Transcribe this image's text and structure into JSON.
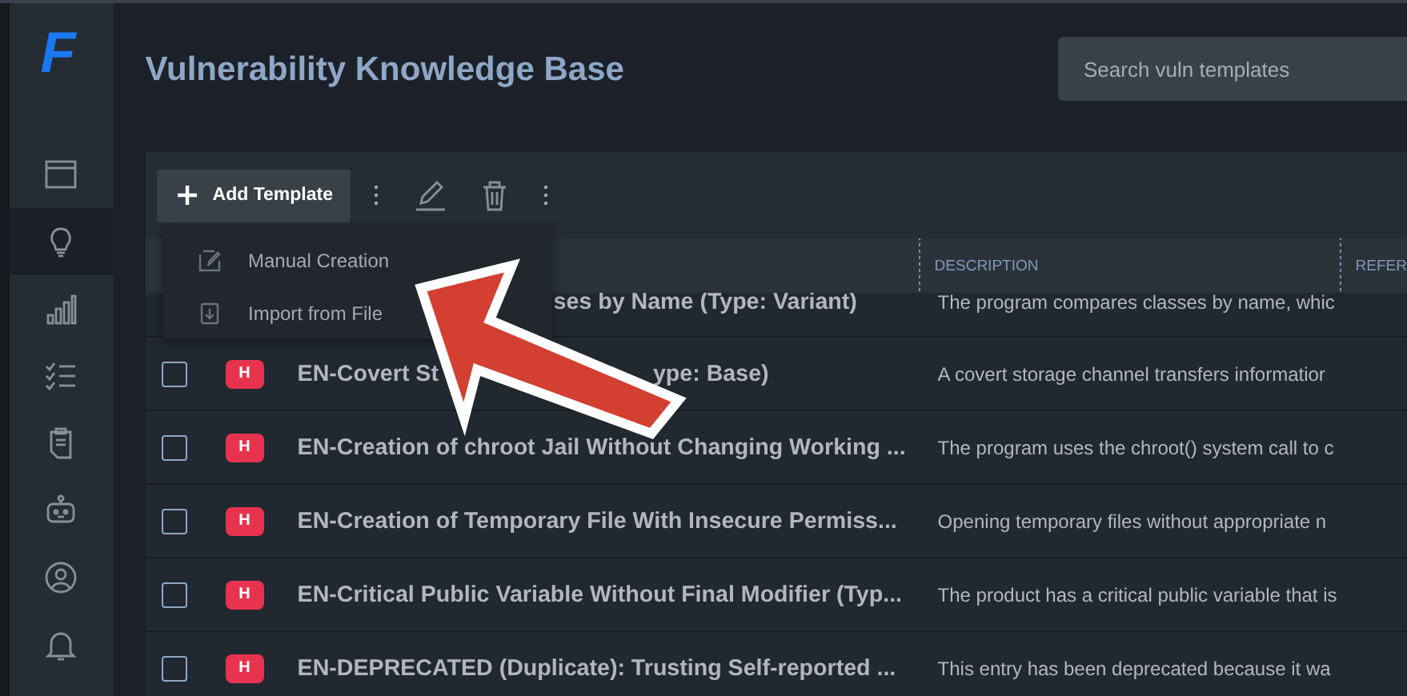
{
  "logo": {
    "text": "F"
  },
  "sidebar": {
    "items": [
      {
        "kind": "window",
        "selected": false
      },
      {
        "kind": "bulb",
        "selected": true
      },
      {
        "kind": "chart",
        "selected": false
      },
      {
        "kind": "checklist",
        "selected": false
      },
      {
        "kind": "clipboard",
        "selected": false
      },
      {
        "kind": "robot",
        "selected": false
      },
      {
        "kind": "user",
        "selected": false
      },
      {
        "kind": "bell",
        "selected": false
      }
    ]
  },
  "header": {
    "title": "Vulnerability Knowledge Base",
    "search": {
      "placeholder": "Search vuln templates"
    }
  },
  "toolbar": {
    "add_button": "Add Template"
  },
  "menu": {
    "items": [
      {
        "kind": "manual",
        "label": "Manual Creation"
      },
      {
        "kind": "import",
        "label": "Import from File"
      }
    ]
  },
  "table": {
    "columns": [
      "DESCRIPTION",
      "REFER"
    ],
    "rows": [
      {
        "kind": "partial",
        "name": "ses by Name (Type: Variant)",
        "description": "The program compares classes by name, whic"
      },
      {
        "kind": "full",
        "checked": false,
        "severity": "H",
        "name": "EN-Covert St",
        "name_tail": "ype: Base)",
        "description": "A covert storage channel transfers informatior"
      },
      {
        "kind": "full",
        "checked": false,
        "severity": "H",
        "name": "EN-Creation of chroot Jail Without Changing Working ...",
        "description": "The program uses the chroot() system call to c"
      },
      {
        "kind": "full",
        "checked": false,
        "severity": "H",
        "name": "EN-Creation of Temporary File With Insecure Permiss...",
        "description": "Opening temporary files without appropriate n"
      },
      {
        "kind": "full",
        "checked": false,
        "severity": "H",
        "name": "EN-Critical Public Variable Without Final Modifier (Typ...",
        "description": "The product has a critical public variable that is"
      },
      {
        "kind": "full",
        "checked": false,
        "severity": "H",
        "name": "EN-DEPRECATED (Duplicate): Trusting Self-reported ...",
        "description": "This entry has been deprecated because it wa"
      }
    ]
  }
}
